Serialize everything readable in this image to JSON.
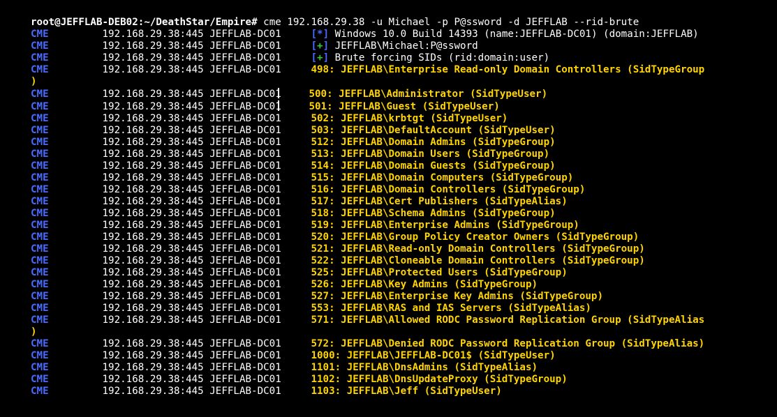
{
  "prompt": {
    "user": "root",
    "host": "JEFFLAB-DEB02",
    "path": "~/DeathStar/Empire",
    "hash": "#",
    "command": "cme 192.168.29.38 -u Michael -p P@ssword -d JEFFLAB --rid-brute"
  },
  "columns": {
    "tag": "CME",
    "target": "192.168.29.38:445",
    "host": "JEFFLAB-DC01"
  },
  "info_lines": [
    {
      "glyph": "*",
      "text": "Windows 10.0 Build 14393 (name:JEFFLAB-DC01) (domain:JEFFLAB)"
    },
    {
      "glyph": "+",
      "text": "JEFFLAB\\Michael:P@ssword"
    },
    {
      "glyph": "+",
      "text": "Brute forcing SIDs (rid:domain:user)"
    }
  ],
  "wrap_paren": ")",
  "cursor_hint": true,
  "rid_rows": [
    {
      "rid": "498",
      "name": "JEFFLAB\\Enterprise Read-only Domain Controllers",
      "type": "SidTypeGroup",
      "wrap": true
    },
    {
      "rid": "500",
      "name": "JEFFLAB\\Administrator",
      "type": "SidTypeUser",
      "cursor_after_dc": true
    },
    {
      "rid": "501",
      "name": "JEFFLAB\\Guest",
      "type": "SidTypeUser",
      "cursor_after_dc": true
    },
    {
      "rid": "502",
      "name": "JEFFLAB\\krbtgt",
      "type": "SidTypeUser"
    },
    {
      "rid": "503",
      "name": "JEFFLAB\\DefaultAccount",
      "type": "SidTypeUser"
    },
    {
      "rid": "512",
      "name": "JEFFLAB\\Domain Admins",
      "type": "SidTypeGroup"
    },
    {
      "rid": "513",
      "name": "JEFFLAB\\Domain Users",
      "type": "SidTypeGroup"
    },
    {
      "rid": "514",
      "name": "JEFFLAB\\Domain Guests",
      "type": "SidTypeGroup"
    },
    {
      "rid": "515",
      "name": "JEFFLAB\\Domain Computers",
      "type": "SidTypeGroup"
    },
    {
      "rid": "516",
      "name": "JEFFLAB\\Domain Controllers",
      "type": "SidTypeGroup"
    },
    {
      "rid": "517",
      "name": "JEFFLAB\\Cert Publishers",
      "type": "SidTypeAlias"
    },
    {
      "rid": "518",
      "name": "JEFFLAB\\Schema Admins",
      "type": "SidTypeGroup"
    },
    {
      "rid": "519",
      "name": "JEFFLAB\\Enterprise Admins",
      "type": "SidTypeGroup"
    },
    {
      "rid": "520",
      "name": "JEFFLAB\\Group Policy Creator Owners",
      "type": "SidTypeGroup"
    },
    {
      "rid": "521",
      "name": "JEFFLAB\\Read-only Domain Controllers",
      "type": "SidTypeGroup"
    },
    {
      "rid": "522",
      "name": "JEFFLAB\\Cloneable Domain Controllers",
      "type": "SidTypeGroup"
    },
    {
      "rid": "525",
      "name": "JEFFLAB\\Protected Users",
      "type": "SidTypeGroup"
    },
    {
      "rid": "526",
      "name": "JEFFLAB\\Key Admins",
      "type": "SidTypeGroup"
    },
    {
      "rid": "527",
      "name": "JEFFLAB\\Enterprise Key Admins",
      "type": "SidTypeGroup"
    },
    {
      "rid": "553",
      "name": "JEFFLAB\\RAS and IAS Servers",
      "type": "SidTypeAlias"
    },
    {
      "rid": "571",
      "name": "JEFFLAB\\Allowed RODC Password Replication Group",
      "type": "SidTypeAlias",
      "wrap": true
    },
    {
      "rid": "572",
      "name": "JEFFLAB\\Denied RODC Password Replication Group",
      "type": "SidTypeAlias"
    },
    {
      "rid": "1000",
      "name": "JEFFLAB\\JEFFLAB-DC01$",
      "type": "SidTypeUser"
    },
    {
      "rid": "1101",
      "name": "JEFFLAB\\DnsAdmins",
      "type": "SidTypeAlias"
    },
    {
      "rid": "1102",
      "name": "JEFFLAB\\DnsUpdateProxy",
      "type": "SidTypeGroup"
    },
    {
      "rid": "1103",
      "name": "JEFFLAB\\Jeff",
      "type": "SidTypeUser"
    }
  ]
}
